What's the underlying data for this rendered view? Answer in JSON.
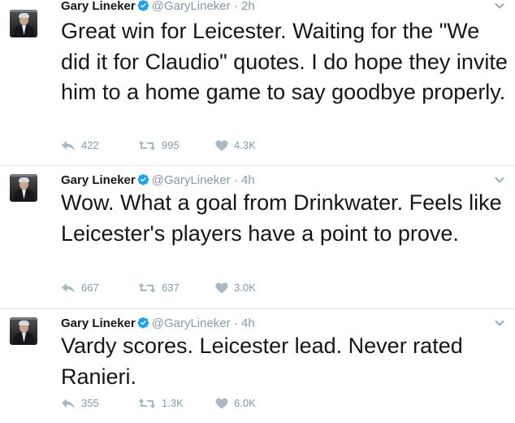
{
  "tweets": [
    {
      "name": "Gary Lineker",
      "handle": "@GaryLineker",
      "separator": "·",
      "time": "2h",
      "text": "Great win for Leicester. Waiting for the \"We did it for Claudio\" quotes. I do hope they invite him to a home game to say goodbye properly.",
      "replies": "422",
      "retweets": "995",
      "likes": "4.3K"
    },
    {
      "name": "Gary Lineker",
      "handle": "@GaryLineker",
      "separator": "·",
      "time": "4h",
      "text": "Wow. What a goal from Drinkwater. Feels like Leicester's players have a point to prove.",
      "replies": "667",
      "retweets": "637",
      "likes": "3.0K"
    },
    {
      "name": "Gary Lineker",
      "handle": "@GaryLineker",
      "separator": "·",
      "time": "4h",
      "text": "Vardy scores. Leicester lead. Never rated Ranieri.",
      "replies": "355",
      "retweets": "1.3K",
      "likes": "6.0K"
    }
  ],
  "icons": {
    "verified": "verified-badge-icon",
    "caret": "chevron-down-icon",
    "reply": "reply-icon",
    "retweet": "retweet-icon",
    "like": "heart-icon"
  },
  "colors": {
    "text": "#14171a",
    "secondary": "#8899a6",
    "verified": "#1da1f2",
    "divider": "#e6ecf0"
  }
}
